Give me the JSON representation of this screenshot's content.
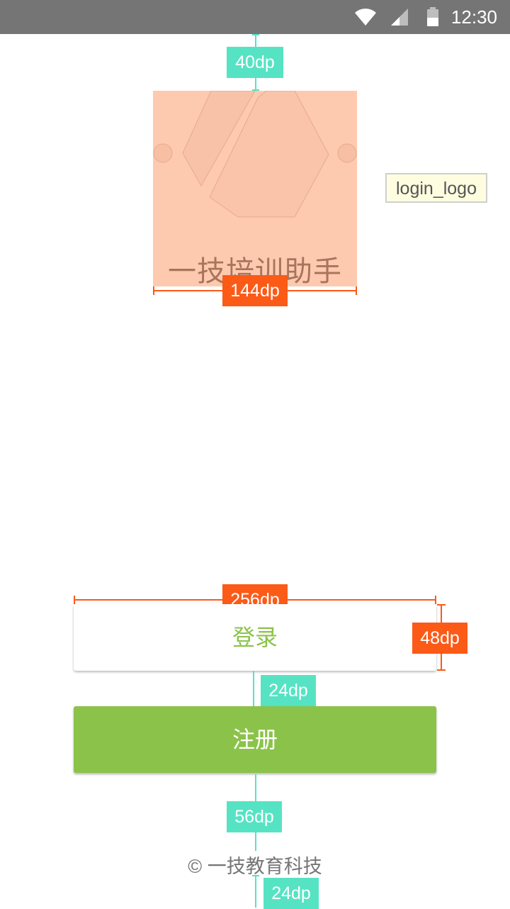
{
  "status_bar": {
    "time": "12:30",
    "icons": [
      "wifi-icon",
      "cell-signal-icon",
      "battery-icon"
    ]
  },
  "logo": {
    "app_name": "一技培训助手",
    "resource_label": "login_logo"
  },
  "buttons": {
    "login": "登录",
    "register": "注册"
  },
  "footer": {
    "copyright": "© 一技教育科技"
  },
  "spec": {
    "top_margin": "40dp",
    "logo_width": "144dp",
    "button_width": "256dp",
    "button_height": "48dp",
    "button_gap": "24dp",
    "footer_gap": "56dp",
    "bottom_margin": "24dp"
  },
  "colors": {
    "status_bar": "#757575",
    "accent_green": "#8bc34a",
    "spec_teal": "#56e3c4",
    "spec_orange": "#fc5a17",
    "logo_bg": "#fdcab0"
  }
}
